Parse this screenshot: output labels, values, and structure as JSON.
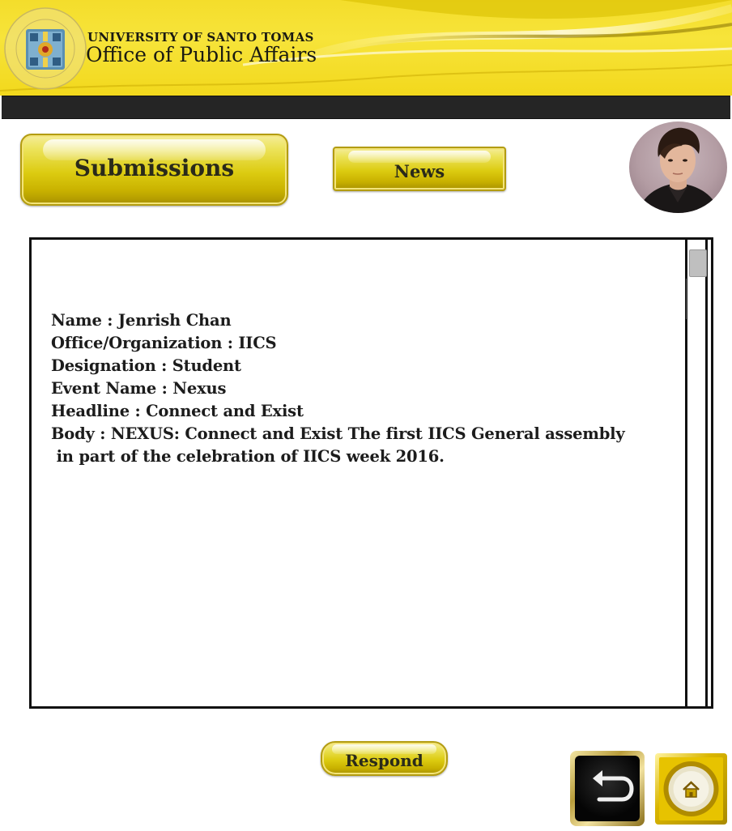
{
  "header": {
    "university": "UNIVERSITY OF SANTO TOMAS",
    "office": "Office of Public Affairs"
  },
  "nav": {
    "submissions_label": "Submissions",
    "news_label": "News"
  },
  "submission": {
    "rows": [
      {
        "label": "Name",
        "value": "Jenrish Chan"
      },
      {
        "label": "Office/Organization",
        "value": "IICS"
      },
      {
        "label": "Designation",
        "value": "Student"
      },
      {
        "label": "Event Name",
        "value": "Nexus"
      },
      {
        "label": "Headline",
        "value": "Connect and Exist"
      },
      {
        "label": "Body",
        "value": "NEXUS: Connect and Exist The first IICS General assembly"
      }
    ],
    "body_continuation": " in part of the celebration of IICS week 2016."
  },
  "actions": {
    "respond_label": "Respond"
  },
  "icons": {
    "back": "back-arrow-icon",
    "home": "home-icon",
    "seal": "ust-seal-logo"
  },
  "colors": {
    "banner_yellow": "#f4dd2b",
    "dark_bar": "#252525",
    "gold": "#dccb10"
  }
}
